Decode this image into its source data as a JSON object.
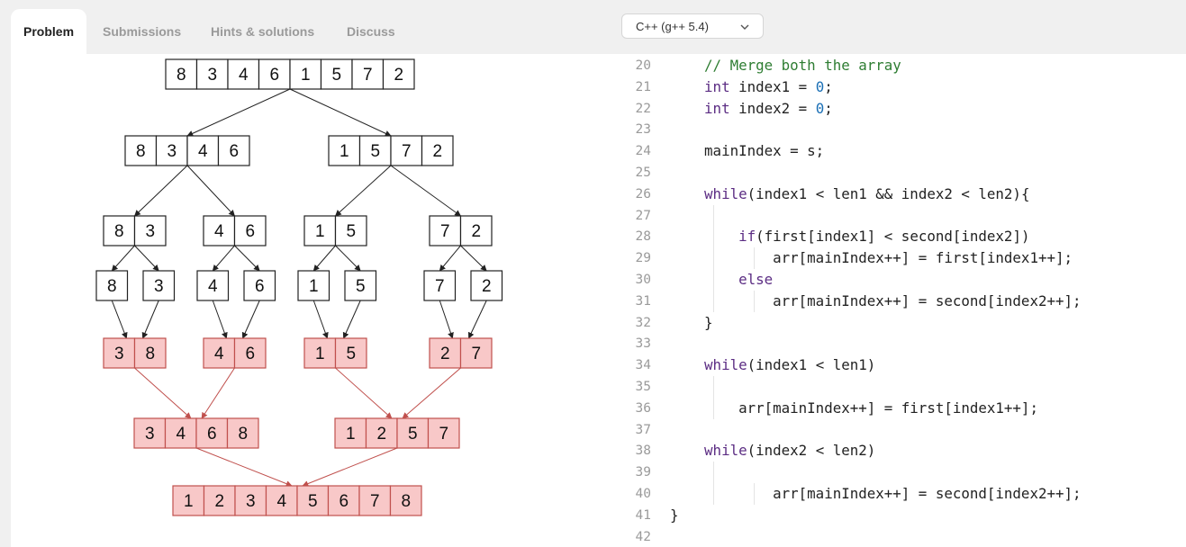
{
  "tabs": [
    {
      "label": "Problem",
      "active": true
    },
    {
      "label": "Submissions",
      "active": false
    },
    {
      "label": "Hints & solutions",
      "active": false
    },
    {
      "label": "Discuss",
      "active": false
    }
  ],
  "language": {
    "selected": "C++ (g++ 5.4)"
  },
  "diagram": {
    "colors": {
      "plain_fill": "#ffffff",
      "sorted_fill": "#f8c8c8",
      "sorted_stroke": "#c0504d",
      "arrow_plain": "#222222",
      "arrow_sorted": "#c0504d"
    },
    "levels": [
      [
        [
          "8",
          "3",
          "4",
          "6",
          "1",
          "5",
          "7",
          "2"
        ]
      ],
      [
        [
          "8",
          "3",
          "4",
          "6"
        ],
        [
          "1",
          "5",
          "7",
          "2"
        ]
      ],
      [
        [
          "8",
          "3"
        ],
        [
          "4",
          "6"
        ],
        [
          "1",
          "5"
        ],
        [
          "7",
          "2"
        ]
      ],
      [
        [
          "8"
        ],
        [
          "3"
        ],
        [
          "4"
        ],
        [
          "6"
        ],
        [
          "1"
        ],
        [
          "5"
        ],
        [
          "7"
        ],
        [
          "2"
        ]
      ],
      [
        [
          "3",
          "8"
        ],
        [
          "4",
          "6"
        ],
        [
          "1",
          "5"
        ],
        [
          "2",
          "7"
        ]
      ],
      [
        [
          "3",
          "4",
          "6",
          "8"
        ],
        [
          "1",
          "2",
          "5",
          "7"
        ]
      ],
      [
        [
          "1",
          "2",
          "3",
          "4",
          "5",
          "6",
          "7",
          "8"
        ]
      ]
    ]
  },
  "code": {
    "lines": [
      {
        "n": "20",
        "text": "    // Merge both the array"
      },
      {
        "n": "21",
        "text": "    int index1 = 0;"
      },
      {
        "n": "22",
        "text": "    int index2 = 0;"
      },
      {
        "n": "23",
        "text": ""
      },
      {
        "n": "24",
        "text": "    mainIndex = s;"
      },
      {
        "n": "25",
        "text": ""
      },
      {
        "n": "26",
        "text": "    while(index1 < len1 && index2 < len2){"
      },
      {
        "n": "27",
        "text": ""
      },
      {
        "n": "28",
        "text": "        if(first[index1] < second[index2])"
      },
      {
        "n": "29",
        "text": "            arr[mainIndex++] = first[index1++];"
      },
      {
        "n": "30",
        "text": "        else"
      },
      {
        "n": "31",
        "text": "            arr[mainIndex++] = second[index2++];"
      },
      {
        "n": "32",
        "text": "    }"
      },
      {
        "n": "33",
        "text": ""
      },
      {
        "n": "34",
        "text": "    while(index1 < len1)"
      },
      {
        "n": "35",
        "text": ""
      },
      {
        "n": "36",
        "text": "        arr[mainIndex++] = first[index1++];"
      },
      {
        "n": "37",
        "text": ""
      },
      {
        "n": "38",
        "text": "    while(index2 < len2)"
      },
      {
        "n": "39",
        "text": ""
      },
      {
        "n": "40",
        "text": "            arr[mainIndex++] = second[index2++];"
      },
      {
        "n": "41",
        "text": "}"
      },
      {
        "n": "42",
        "text": ""
      }
    ]
  }
}
